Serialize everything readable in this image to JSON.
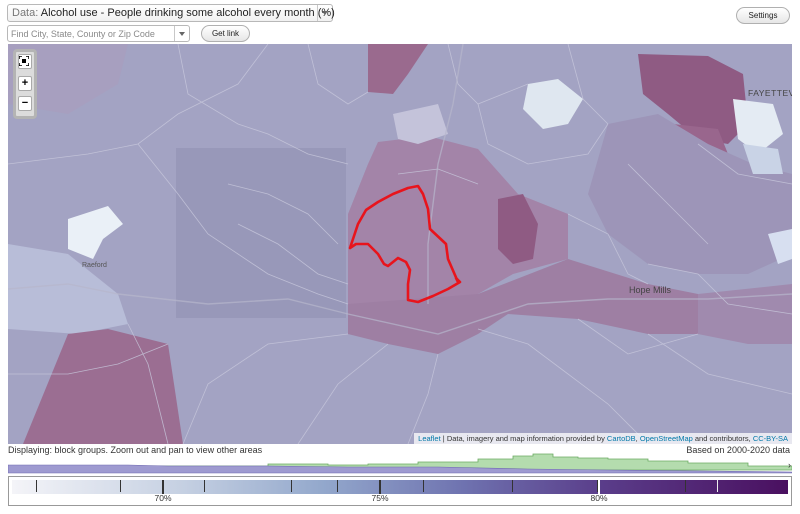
{
  "toolbar": {
    "data_prefix": "Data:",
    "data_value": "Alcohol use - People drinking some alcohol every month (%)",
    "location_placeholder": "Find City, State, County or Zip Code",
    "get_link_label": "Get link",
    "settings_label": "Settings"
  },
  "map": {
    "zoom_in": "+",
    "zoom_out": "−",
    "labels": {
      "fayetteville": "FAYETTEV",
      "raeford": "Raeford",
      "hope_mills": "Hope Mills"
    },
    "attribution": {
      "leaflet": "Leaflet",
      "text1": " | Data, imagery and map information provided by ",
      "cartodb": "CartoDB",
      "sep": ", ",
      "osm": "OpenStreetMap",
      "text2": " and contributors, ",
      "license": "CC-BY-SA"
    },
    "colors": {
      "highlight_outline": "#e8141c",
      "darkest_fill": "#8c3f72",
      "light_fill": "#dce6f0"
    }
  },
  "status": {
    "displaying": "Displaying: block groups. Zoom out and pan to view other areas",
    "based_on": "Based on 2000-2020 data"
  },
  "legend": {
    "ticks": [
      {
        "label": "70%"
      },
      {
        "label": "75%"
      },
      {
        "label": "80%"
      }
    ],
    "arrow": "›"
  }
}
